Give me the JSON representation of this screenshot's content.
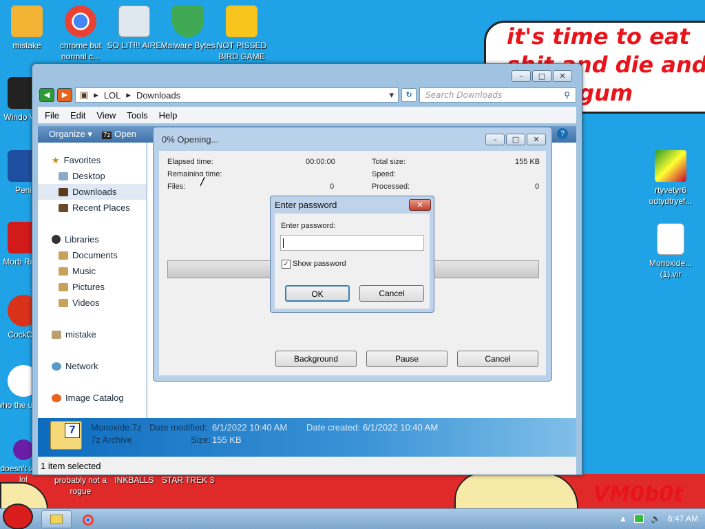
{
  "desktop": {
    "icons_left": [
      {
        "label": "mistake",
        "color": "#f2b233"
      },
      {
        "label": "chrome but normal c...",
        "color": "#e94234"
      },
      {
        "label": "SO LIT!!! AIRE",
        "color": "#dfe8ee"
      },
      {
        "label": "Malware Bytes",
        "color": "#3ea852"
      },
      {
        "label": "NOT PISSED BIRD GAME",
        "color": "#f7c51e"
      }
    ],
    "icons_column": [
      {
        "label": "Windo Vist",
        "color": "#222222"
      },
      {
        "label": "Peni",
        "color": "#1f4fa0"
      },
      {
        "label": "Morb Read",
        "color": "#d11a1a"
      },
      {
        "label": "CockCle",
        "color": "#d9321a"
      },
      {
        "label": "who the uses t",
        "color": "#ff7a1a"
      },
      {
        "label": "doesn't work lol",
        "color": "#6a1ea8"
      }
    ],
    "icons_bottom": [
      {
        "label": "probably not a rogue"
      },
      {
        "label": "INKBALLS"
      },
      {
        "label": "STAR TREK 3"
      }
    ],
    "icons_right": [
      {
        "label": "rtyvetyr6 udtydtryef...",
        "color": "#2a9a2a"
      },
      {
        "label": "Monoxide... (1).vir",
        "color": "#ffffff"
      }
    ],
    "speech_text": "it's time to eat shit and die and chew gum",
    "signature": "VM0b0t"
  },
  "explorer": {
    "address": {
      "crumbs": [
        "LOL",
        "Downloads"
      ]
    },
    "search_placeholder": "Search Downloads",
    "menu": [
      "File",
      "Edit",
      "View",
      "Tools",
      "Help"
    ],
    "toolbar": {
      "organize": "Organize",
      "open": "Open"
    },
    "nav": {
      "favorites": "Favorites",
      "desktop": "Desktop",
      "downloads": "Downloads",
      "recent": "Recent Places",
      "libraries": "Libraries",
      "documents": "Documents",
      "music": "Music",
      "pictures": "Pictures",
      "videos": "Videos",
      "mistake": "mistake",
      "network": "Network",
      "image_catalog": "Image Catalog"
    },
    "details": {
      "name": "Monoxide.7z",
      "type": "7z Archive",
      "modified_label": "Date modified:",
      "modified_value": "6/1/2022 10:40 AM",
      "created_label": "Date created:",
      "created_value": "6/1/2022 10:40 AM",
      "size_label": "Size:",
      "size_value": "155 KB"
    },
    "status": "1 item selected"
  },
  "progress": {
    "title": "0% Opening...",
    "elapsed_label": "Elapsed time:",
    "elapsed_value": "00:00:00",
    "remaining_label": "Remaining time:",
    "files_label": "Files:",
    "files_value": "0",
    "total_label": "Total size:",
    "total_value": "155 KB",
    "speed_label": "Speed:",
    "processed_label": "Processed:",
    "processed_value": "0",
    "percent": 0,
    "btn_background": "Background",
    "btn_pause": "Pause",
    "btn_cancel": "Cancel"
  },
  "password_dialog": {
    "title": "Enter password",
    "label": "Enter password:",
    "value": "",
    "show_password_label": "Show password",
    "show_password_checked": true,
    "ok": "OK",
    "cancel": "Cancel"
  },
  "taskbar": {
    "time": "6:47 AM"
  }
}
